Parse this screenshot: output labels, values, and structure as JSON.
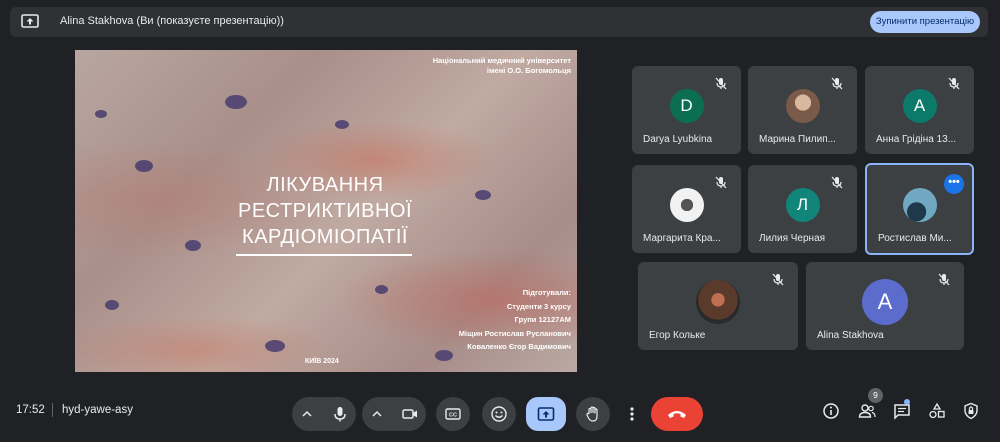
{
  "banner": {
    "title": "Alina Stakhova (Ви (показуєте презентацію))",
    "stop_button": "Зупинити презентацію"
  },
  "slide": {
    "org_line1": "Національний медичний університет",
    "org_line2": "імені О.О. Богомольця",
    "title_line1": "ЛІКУВАННЯ",
    "title_line2": "РЕСТРИКТИВНОЇ",
    "title_line3": "КАРДІОМІОПАТІЇ",
    "prepared_line1": "Підготували:",
    "prepared_line2": "Студенти 3 курсу",
    "prepared_line3": "Групи 12127АМ",
    "prepared_line4": "Міщин Ростислав Русланович",
    "prepared_line5": "Коваленко Єгор Вадимович",
    "city_year": "КИЇВ 2024"
  },
  "participants": [
    {
      "name": "Darya Lyubkina",
      "initial": "D",
      "avatar_color": "#0b6e4f",
      "muted": true
    },
    {
      "name": "Марина Пилип...",
      "initial": "",
      "avatar_color": "#9a7b6a",
      "muted": true
    },
    {
      "name": "Анна Грідіна 13...",
      "initial": "A",
      "avatar_color": "#0b7a6b",
      "muted": true
    },
    {
      "name": "Маргарита Кра...",
      "initial": "",
      "avatar_color": "#e8e8e8",
      "muted": true
    },
    {
      "name": "Лилия Черная",
      "initial": "Л",
      "avatar_color": "#12857a",
      "muted": true
    },
    {
      "name": "Ростислав Ми...",
      "initial": "",
      "avatar_color": "#4a7a8a",
      "muted": false,
      "active": true
    },
    {
      "name": "Егор Кольке",
      "initial": "",
      "avatar_color": "#6a4a3a",
      "muted": true
    },
    {
      "name": "Alina Stakhova",
      "initial": "A",
      "avatar_color": "#5b6ccc",
      "muted": true
    }
  ],
  "more_button": "•••",
  "bottom": {
    "time": "17:52",
    "meeting_code": "hyd-yawe-asy",
    "people_count": "9"
  },
  "colors": {
    "accent": "#a8c7fa",
    "hangup": "#ea4335",
    "background": "#202124",
    "tile": "#3c4043"
  },
  "icons": [
    "present-to-all-icon",
    "mic-icon",
    "camera-icon",
    "captions-icon",
    "emoji-icon",
    "raise-hand-icon",
    "more-vert-icon",
    "call-end-icon",
    "info-icon",
    "people-icon",
    "chat-icon",
    "activities-icon",
    "host-controls-icon",
    "mic-off-icon",
    "chevron-up-icon"
  ]
}
